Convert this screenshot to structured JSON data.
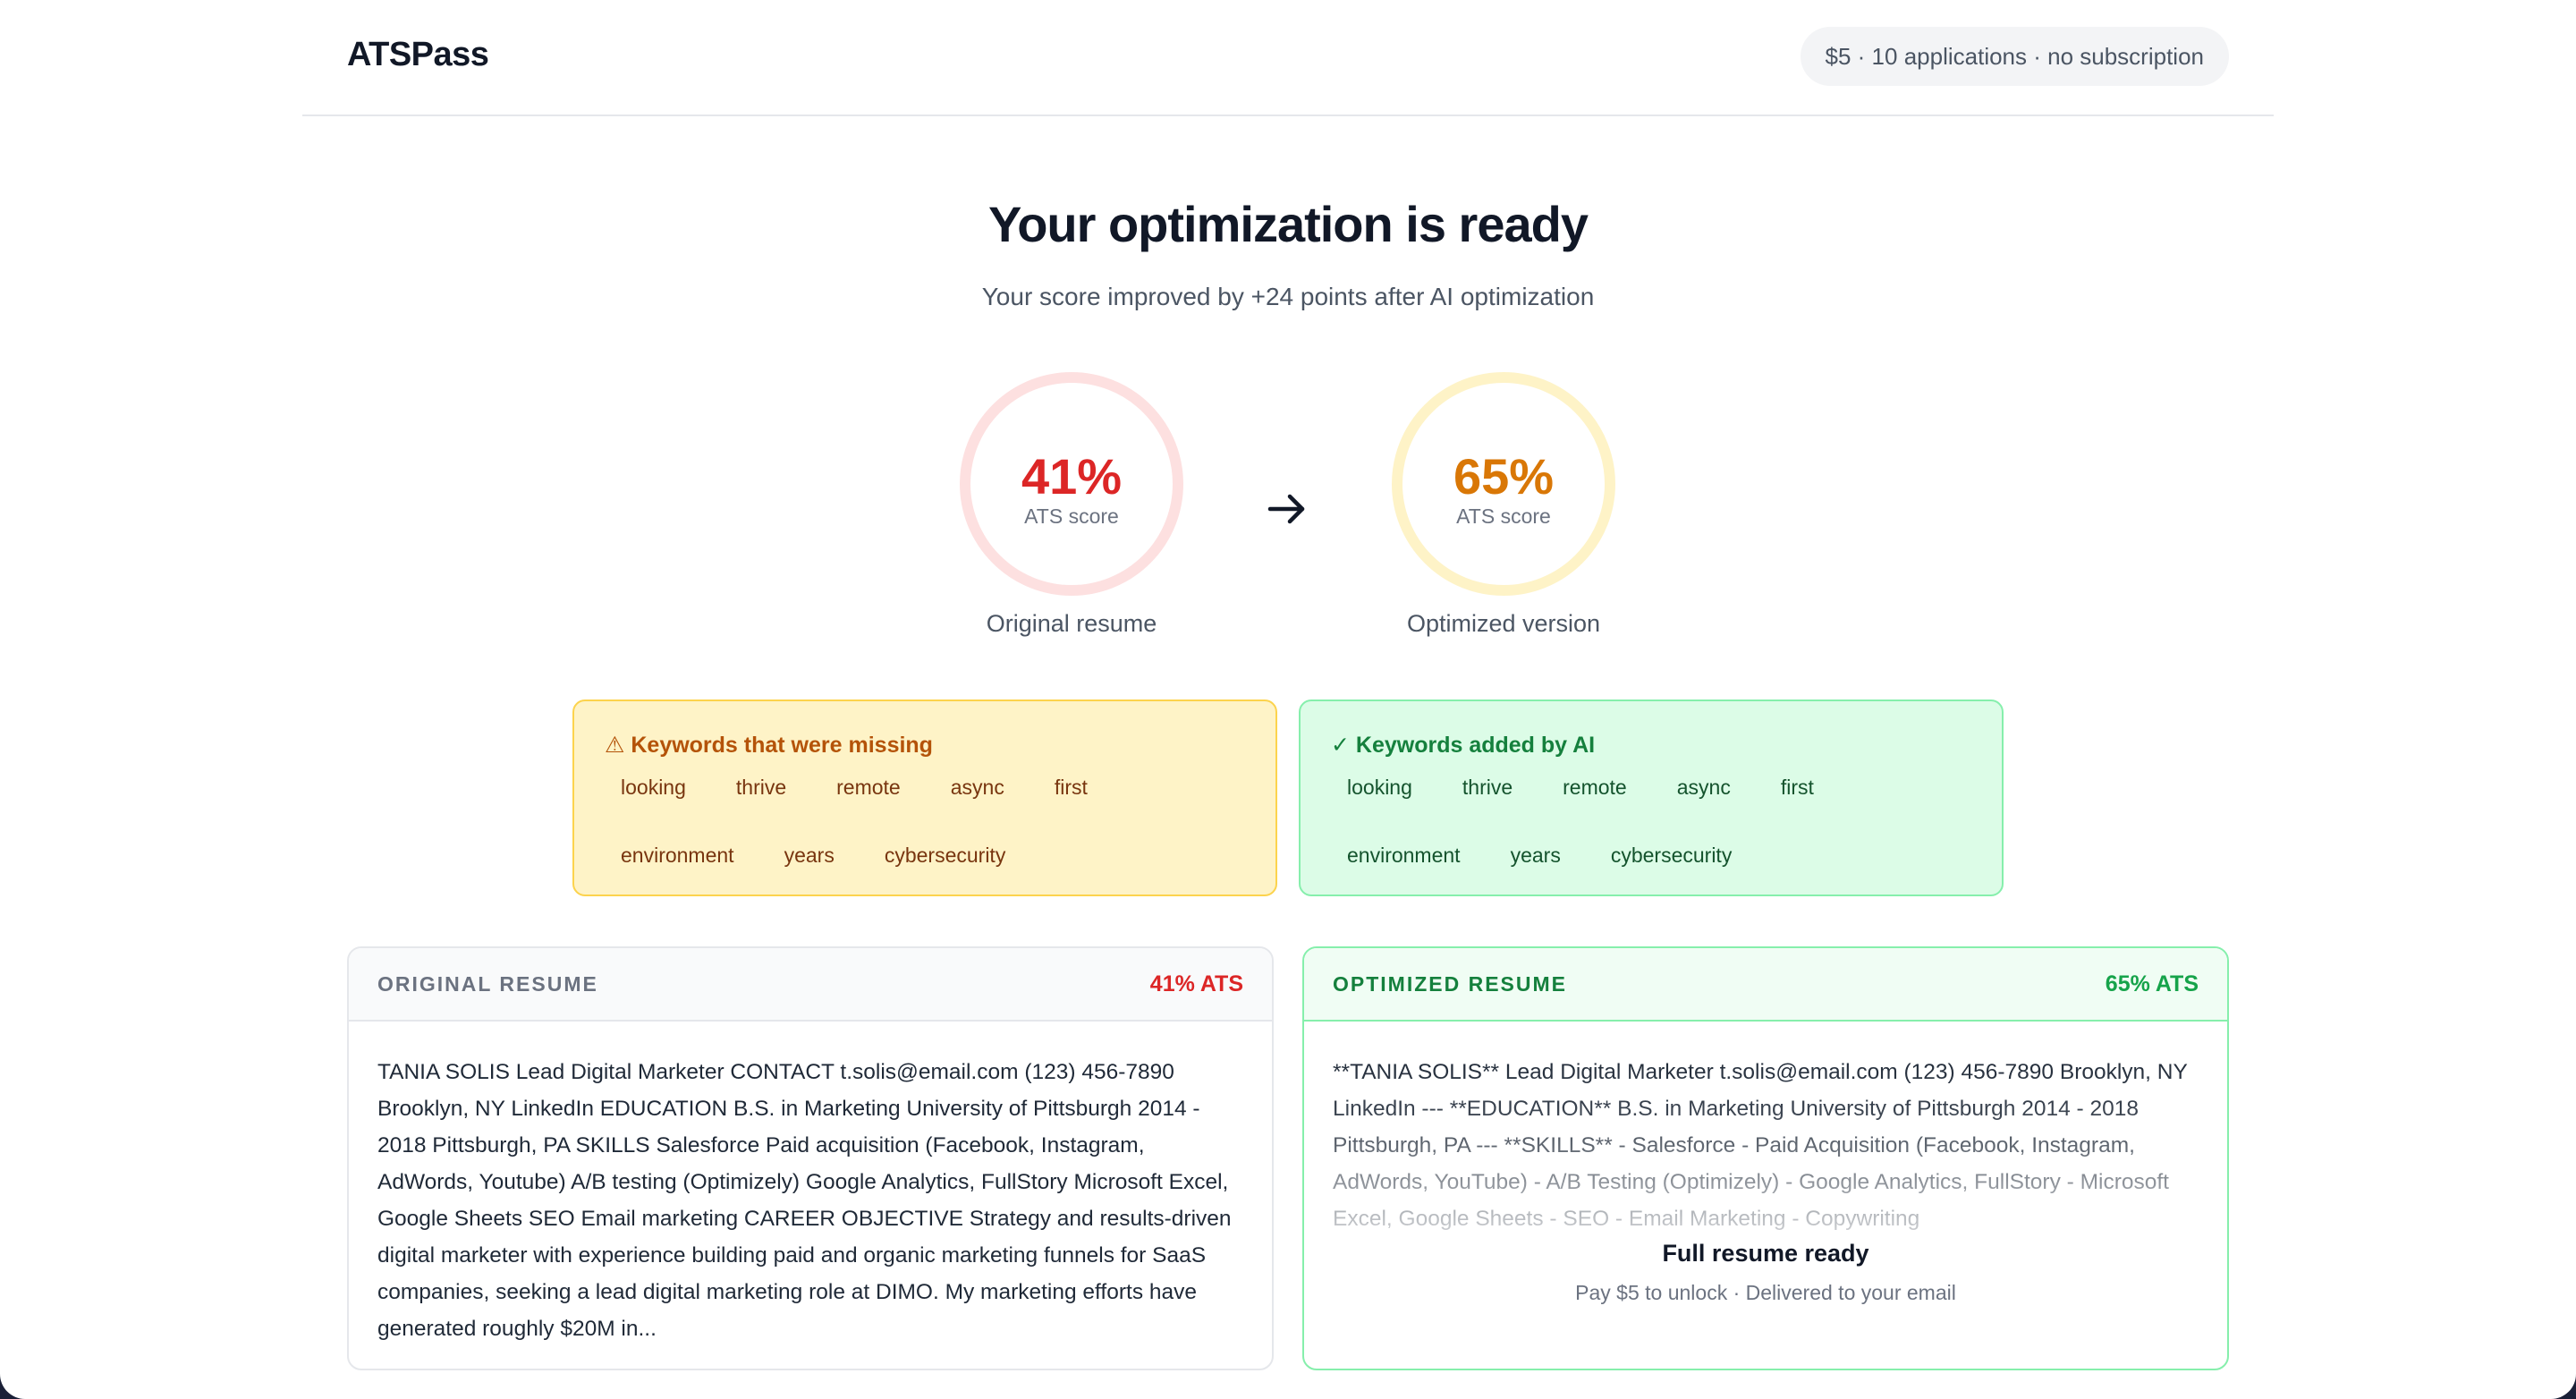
{
  "header": {
    "logo": "ATSPass",
    "pricing": "$5 · 10 applications · no subscription"
  },
  "hero": {
    "title": "Your optimization is ready",
    "subtitle": "Your score improved by +24 points after AI optimization"
  },
  "scores": {
    "original": {
      "value": "41%",
      "label": "ATS score",
      "caption": "Original resume"
    },
    "optimized": {
      "value": "65%",
      "label": "ATS score",
      "caption": "Optimized version"
    }
  },
  "keywords": {
    "missing": {
      "icon": "warning-icon",
      "title": "⚠ Keywords that were missing",
      "items": [
        "looking",
        "thrive",
        "remote",
        "async",
        "first",
        "environment",
        "years",
        "cybersecurity"
      ]
    },
    "added": {
      "icon": "check-icon",
      "title": "✓ Keywords added by AI",
      "items": [
        "looking",
        "thrive",
        "remote",
        "async",
        "first",
        "environment",
        "years",
        "cybersecurity"
      ]
    }
  },
  "original_resume": {
    "title": "ORIGINAL RESUME",
    "score": "41% ATS",
    "text": "TANIA SOLIS Lead Digital Marketer CONTACT t.solis@email.com (123) 456-7890 Brooklyn, NY LinkedIn EDUCATION B.S. in Marketing University of Pittsburgh 2014 - 2018 Pittsburgh, PA SKILLS Salesforce Paid acquisition (Facebook, Instagram, AdWords, Youtube) A/B testing (Optimizely) Google Analytics, FullStory Microsoft Excel, Google Sheets SEO Email marketing CAREER OBJECTIVE Strategy and results-driven digital marketer with experience building paid and organic marketing funnels for SaaS companies, seeking a lead digital marketing role at DIMO. My marketing efforts have generated roughly $20M in..."
  },
  "optimized_resume": {
    "title": "OPTIMIZED RESUME",
    "score": "65% ATS",
    "text": "**TANIA SOLIS** Lead Digital Marketer t.solis@email.com (123) 456-7890 Brooklyn, NY LinkedIn --- **EDUCATION** B.S. in Marketing University of Pittsburgh 2014 - 2018 Pittsburgh, PA --- **SKILLS** - Salesforce - Paid Acquisition (Facebook, Instagram, AdWords, YouTube) - A/B Testing (Optimizely) - Google Analytics, FullStory - Microsoft Excel, Google Sheets - SEO - Email Marketing - Copywriting",
    "unlock_title": "Full resume ready",
    "unlock_subtitle": "Pay $5 to unlock · Delivered to your email"
  },
  "colors": {
    "bad": "#dc2626",
    "mid": "#d97706",
    "good": "#16a34a",
    "backdrop": "#1a2037"
  }
}
